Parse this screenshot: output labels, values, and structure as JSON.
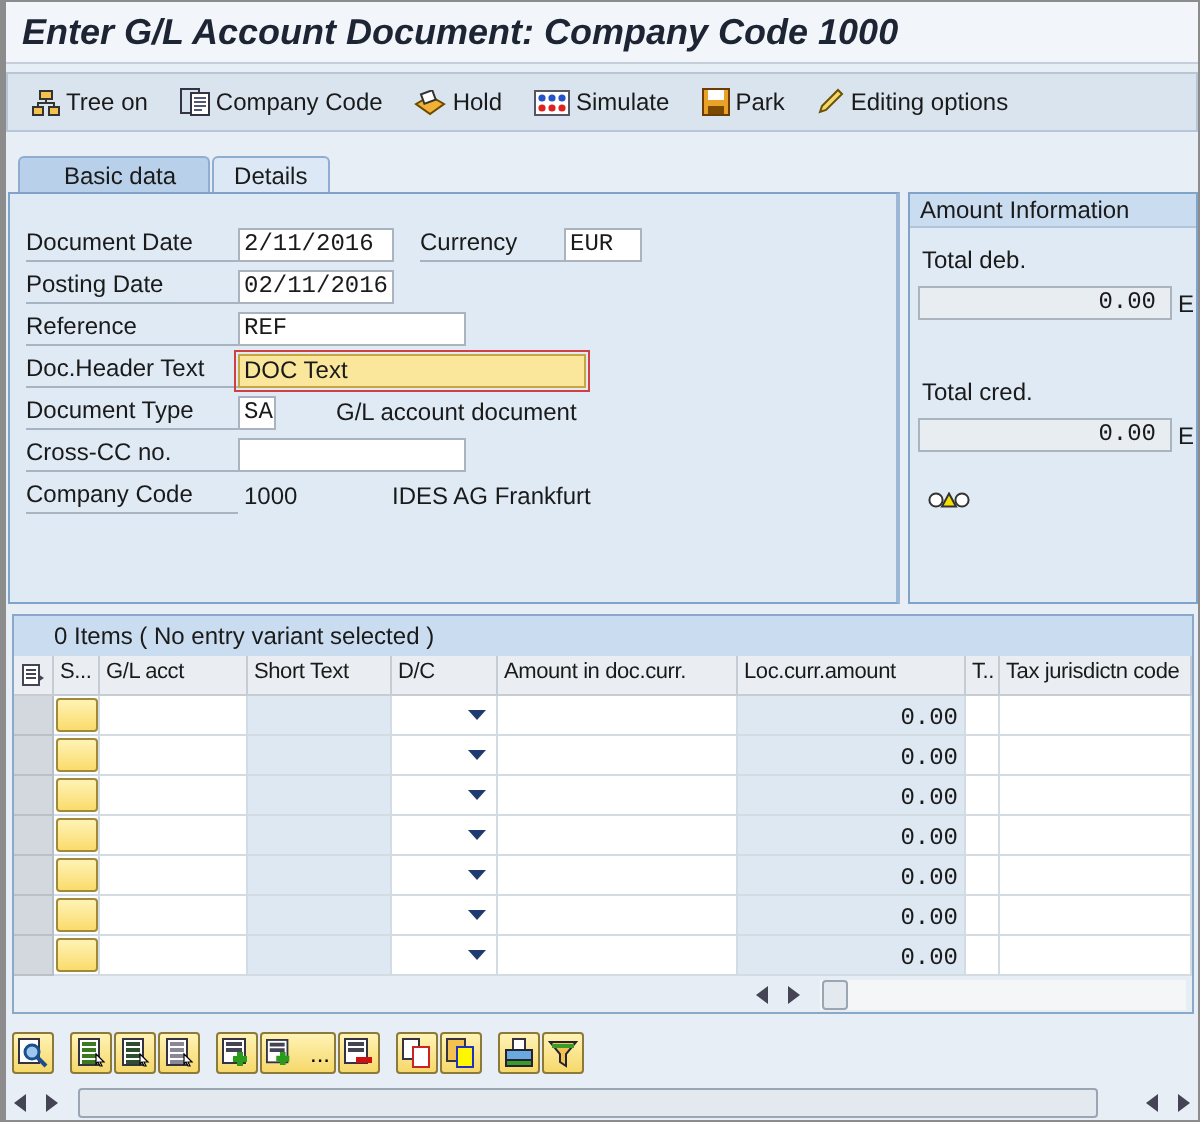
{
  "window": {
    "title": "Enter G/L Account Document: Company Code 1000"
  },
  "toolbar": [
    {
      "kind": "tree",
      "label": "Tree on"
    },
    {
      "kind": "company",
      "label": "Company Code"
    },
    {
      "kind": "hold",
      "label": "Hold"
    },
    {
      "kind": "simulate",
      "label": "Simulate"
    },
    {
      "kind": "park",
      "label": "Park"
    },
    {
      "kind": "edit",
      "label": "Editing options"
    }
  ],
  "tabs": [
    {
      "label": "Basic data",
      "selected": true
    },
    {
      "label": "Details",
      "selected": false
    }
  ],
  "form": {
    "rows": [
      {
        "label": "Document Date",
        "kind": "date",
        "value": "2/11/2016",
        "focused": false,
        "aside": {
          "label": "Currency",
          "value": "EUR"
        }
      },
      {
        "label": "Posting Date",
        "kind": "date",
        "value": "02/11/2016",
        "focused": false
      },
      {
        "label": "Reference",
        "kind": "text",
        "value": "REF",
        "focused": false
      },
      {
        "label": "Doc.Header Text",
        "kind": "long",
        "value": "DOC Text",
        "focused": true
      },
      {
        "label": "Document Type",
        "kind": "code",
        "value": "SA",
        "focused": false,
        "note": "G/L account document"
      },
      {
        "label": "Cross-CC no.",
        "kind": "text",
        "focused": false
      },
      {
        "label": "Company Code",
        "kind": "display",
        "value": "1000",
        "note": "IDES AG Frankfurt"
      }
    ]
  },
  "amount_information": {
    "title": "Amount Information",
    "totals": [
      {
        "label": "Total deb.",
        "value": "0.00",
        "unit": "E"
      },
      {
        "label": "Total cred.",
        "value": "0.00",
        "unit": "E"
      }
    ]
  },
  "items_table": {
    "caption": "0 Items ( No entry variant selected )",
    "columns": [
      "S...",
      "G/L acct",
      "Short Text",
      "D/C",
      "Amount in doc.curr.",
      "Loc.curr.amount",
      "T..",
      "Tax jurisdictn code"
    ],
    "rows": [
      {
        "loc_curr_amount": "0.00"
      },
      {
        "loc_curr_amount": "0.00"
      },
      {
        "loc_curr_amount": "0.00"
      },
      {
        "loc_curr_amount": "0.00"
      },
      {
        "loc_curr_amount": "0.00"
      },
      {
        "loc_curr_amount": "0.00"
      },
      {
        "loc_curr_amount": "0.00"
      }
    ]
  },
  "bottom_toolbar": {
    "more_label": "..."
  }
}
